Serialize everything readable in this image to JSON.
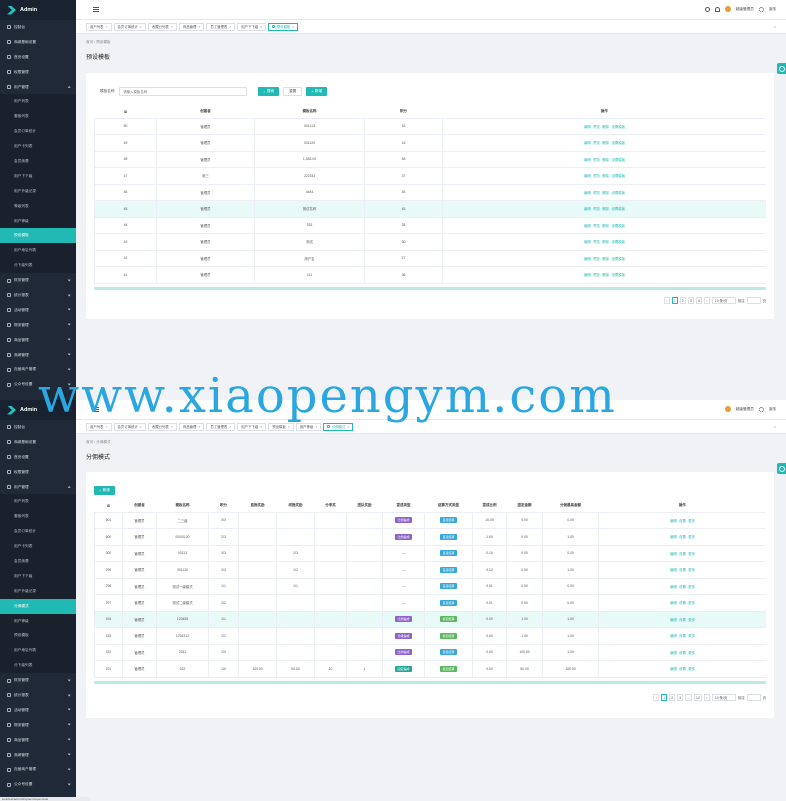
{
  "app": {
    "title": "Admin"
  },
  "topbar": {
    "username": "超级管理员",
    "settings_label": "宣传"
  },
  "watermark": "www.xiaopengym.com",
  "status_url": "localhost/admin/#/system/supermode",
  "screen_a": {
    "sidebar": {
      "items_before": [
        {
          "label": "控制台",
          "expandable": false
        },
        {
          "label": "商城基础设置",
          "expandable": false
        },
        {
          "label": "首页设置",
          "expandable": false
        },
        {
          "label": "权限管理",
          "expandable": false
        }
      ],
      "open_group": {
        "label": "用户管理"
      },
      "sub_items": [
        "用户列表",
        "看板列表",
        "会员订单统计",
        "用户卡列表",
        "会员续费",
        "用户下下级",
        "用户升级记录",
        "等级列表",
        "用户等级",
        "预设模板",
        "用户地址列表",
        "分下级列表"
      ],
      "active_sub_index": 9,
      "items_after": [
        "财务管理",
        "统计报表",
        "活动管理",
        "物流管理",
        "商品管理",
        "商城管理",
        "自营商户管理",
        "公众号设置"
      ]
    },
    "tabs": [
      {
        "label": "用户列表",
        "active": false
      },
      {
        "label": "会员订单统计",
        "active": false
      },
      {
        "label": "收藏分列表",
        "active": false
      },
      {
        "label": "商品管理",
        "active": false
      },
      {
        "label": "员工管理表",
        "active": false
      },
      {
        "label": "用户下下级",
        "active": false
      },
      {
        "label": "预设模板",
        "active": true
      }
    ],
    "breadcrumb": "首页 / 预设模板",
    "page_title": "预设模板",
    "search": {
      "label": "模板名称:",
      "placeholder": "请输入模板名称",
      "search_label": "搜索",
      "reset_label": "重置",
      "add_label": "新增"
    },
    "table": {
      "columns": [
        "ID",
        "创建者",
        "模板名称",
        "积分",
        "操作"
      ],
      "rows": [
        {
          "id": "50",
          "creator": "管理员",
          "name": "001113",
          "points": "18"
        },
        {
          "id": "49",
          "creator": "管理员",
          "name": "001120",
          "points": "15"
        },
        {
          "id": "48",
          "creator": "管理员",
          "name": "1,345.00",
          "points": "48"
        },
        {
          "id": "47",
          "creator": "张三",
          "name": "222333",
          "points": "37"
        },
        {
          "id": "46",
          "creator": "管理员",
          "name": "4444",
          "points": "45"
        },
        {
          "id": "45",
          "creator": "管理员",
          "name": "测试名称",
          "points": "45"
        },
        {
          "id": "44",
          "creator": "管理员",
          "name": "333",
          "points": "28"
        },
        {
          "id": "43",
          "creator": "管理员",
          "name": "测试",
          "points": "30"
        },
        {
          "id": "42",
          "creator": "管理员",
          "name": "用户名",
          "points": "27"
        },
        {
          "id": "41",
          "creator": "管理员",
          "name": "111",
          "points": "36"
        }
      ],
      "highlight_index": 5,
      "ops": [
        "编辑",
        "预览",
        "删除",
        "设置模板"
      ]
    },
    "pager": {
      "pages": [
        "1",
        "2",
        "3",
        "4"
      ],
      "active": "1",
      "page_size": "10 条/页",
      "goto_label": "前往",
      "goto_suffix": "页"
    }
  },
  "screen_b": {
    "sidebar": {
      "items_before": [
        {
          "label": "控制台",
          "expandable": false
        },
        {
          "label": "商城基础设置",
          "expandable": false
        },
        {
          "label": "首页设置",
          "expandable": false
        },
        {
          "label": "权限管理",
          "expandable": false
        }
      ],
      "open_group": {
        "label": "用户管理"
      },
      "sub_items": [
        "用户列表",
        "看板列表",
        "会员订单统计",
        "用户卡列表",
        "会员续费",
        "用户下下级",
        "用户升级记录",
        "分佣模式",
        "用户等级",
        "预设模板",
        "用户地址列表",
        "分下级列表"
      ],
      "active_sub_index": 7,
      "items_after": [
        "财务管理",
        "统计报表",
        "活动管理",
        "物流管理",
        "商品管理",
        "商城管理",
        "自营商户管理",
        "公众号设置"
      ]
    },
    "tabs": [
      {
        "label": "用户列表",
        "active": false
      },
      {
        "label": "会员订单统计",
        "active": false
      },
      {
        "label": "收藏分列表",
        "active": false
      },
      {
        "label": "商品管理",
        "active": false
      },
      {
        "label": "员工管理表",
        "active": false
      },
      {
        "label": "用户下下级",
        "active": false
      },
      {
        "label": "预设模板",
        "active": false
      },
      {
        "label": "用户等级",
        "active": false
      },
      {
        "label": "分佣模式",
        "active": true
      }
    ],
    "breadcrumb": "首页 / 分佣模式",
    "page_title": "分佣模式",
    "add_label": "新增",
    "table": {
      "columns": [
        "ID",
        "创建者",
        "模板名称",
        "积分",
        "直推奖励",
        "间推奖励",
        "分享奖",
        "团队奖励",
        "提成类型",
        "结算方式类型",
        "提成比例",
        "固定金额",
        "分佣最高金额",
        "操作"
      ],
      "rows": [
        {
          "cells": [
            "601",
            "管理员",
            "二三级",
            "3/3",
            "",
            "",
            "",
            "",
            "",
            "",
            "10.00",
            "0.00",
            "0.00"
          ],
          "tag1": {
            "text": "比例提成",
            "color": "purple"
          },
          "tag2": {
            "text": "直接结算",
            "color": "blue"
          }
        },
        {
          "cells": [
            "600",
            "管理员",
            "00000.00",
            "2/3",
            "",
            "",
            "",
            "",
            "",
            "",
            "1.00",
            "0.00",
            "1.00"
          ],
          "tag1": {
            "text": "比例提成",
            "color": "purple"
          },
          "tag2": {
            "text": "直接结算",
            "color": "blue"
          }
        },
        {
          "cells": [
            "300",
            "管理员",
            "00113",
            "3/3",
            "",
            "2/3",
            "",
            "",
            "—",
            "",
            "0.10",
            "0.00",
            "0.00"
          ],
          "tag1": null,
          "tag2": {
            "text": "直接结算",
            "color": "blue"
          }
        },
        {
          "cells": [
            "299",
            "管理员",
            "001120",
            "2/3",
            "",
            "1/2",
            "",
            "",
            "—",
            "",
            "0.12",
            "0.00",
            "1.00"
          ],
          "tag1": null,
          "tag2": {
            "text": "直接结算",
            "color": "blue"
          }
        },
        {
          "cells": [
            "298",
            "管理员",
            "测试一级模式",
            "1/1",
            "",
            "1/1",
            "",
            "",
            "—",
            "",
            "0.01",
            "0.00",
            "0.00"
          ],
          "tag1": null,
          "tag2": {
            "text": "直接结算",
            "color": "blue"
          }
        },
        {
          "cells": [
            "297",
            "管理员",
            "测试二级模式",
            "2/2",
            "",
            "",
            "",
            "",
            "—",
            "",
            "0.01",
            "0.00",
            "0.00"
          ],
          "tag1": null,
          "tag2": {
            "text": "直接结算",
            "color": "blue"
          }
        },
        {
          "cells": [
            "154",
            "管理员",
            "123455",
            "1/1",
            "",
            "",
            "",
            "",
            "",
            "",
            "0.00",
            "1.00",
            "1.00"
          ],
          "tag1": {
            "text": "比例提成",
            "color": "purple"
          },
          "tag2": {
            "text": "延迟结算",
            "color": "green"
          }
        },
        {
          "cells": [
            "153",
            "管理员",
            "1234312",
            "1/1",
            "",
            "",
            "",
            "",
            "",
            "",
            "0.00",
            "1.00",
            "1.00"
          ],
          "tag1": {
            "text": "分级提成",
            "color": "purple"
          },
          "tag2": {
            "text": "延迟结算",
            "color": "green"
          }
        },
        {
          "cells": [
            "152",
            "管理员",
            "2341",
            "1/0",
            "",
            "",
            "",
            "",
            "",
            "",
            "0.00",
            "100.00",
            "1.00"
          ],
          "tag1": {
            "text": "比例提成",
            "color": "purple"
          },
          "tag2": {
            "text": "直接结算",
            "color": "blue"
          }
        },
        {
          "cells": [
            "151",
            "管理员",
            "222",
            "1/0",
            "100.00",
            "50.00",
            "10",
            "1",
            "",
            "",
            "0.00",
            "50.00",
            "100.00"
          ],
          "tag1": {
            "text": "固定提成",
            "color": "teal"
          },
          "tag2": {
            "text": "延迟结算",
            "color": "green"
          }
        }
      ],
      "highlight_index": 6,
      "ops": [
        "编辑",
        "设置",
        "更多"
      ]
    },
    "pager": {
      "pages": [
        "1",
        "2",
        "3",
        "...",
        "12"
      ],
      "active": "1",
      "page_size": "10 条/页",
      "goto_label": "前往",
      "goto_suffix": "页"
    }
  }
}
